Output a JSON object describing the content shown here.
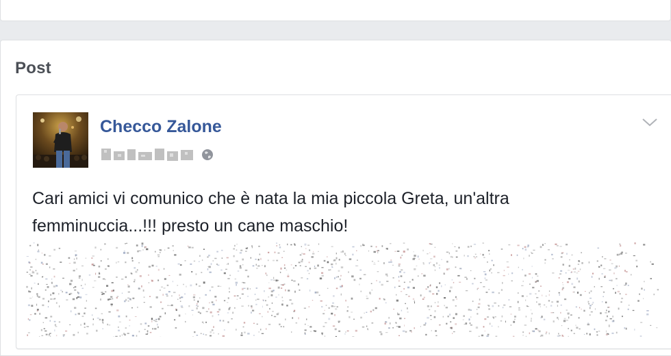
{
  "section": {
    "title": "Post"
  },
  "post": {
    "author": "Checco Zalone",
    "text_line1": "Cari amici vi comunico che è nata la mia piccola Greta, un'altra",
    "text_line2": "femminuccia...!!! presto un cane maschio!"
  },
  "icons": {
    "privacy": "globe-icon",
    "menu": "chevron-down-icon"
  },
  "colors": {
    "author_link": "#365899",
    "page_background": "#e9ebee",
    "section_title": "#4b4f56",
    "body_text": "#1d2129"
  }
}
